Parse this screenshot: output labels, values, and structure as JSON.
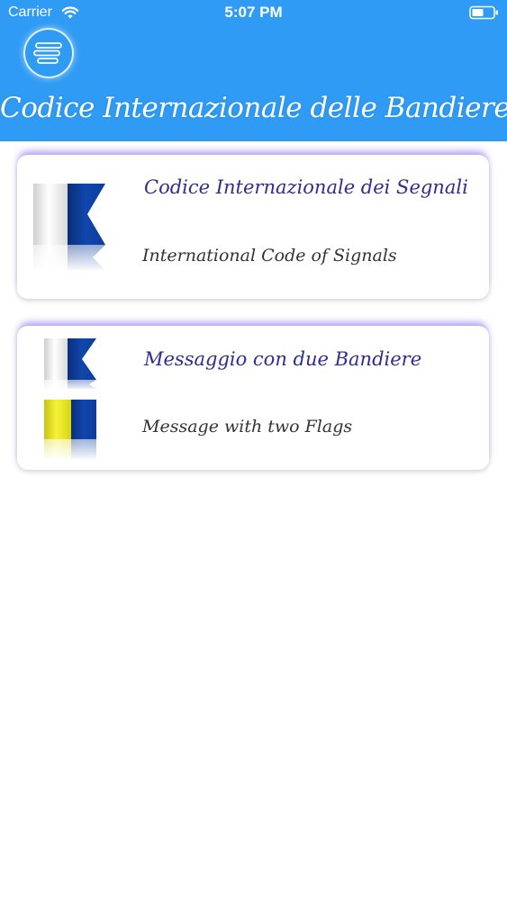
{
  "status_bar": {
    "carrier": "Carrier",
    "time": "5:07 PM",
    "wifi_icon": "wifi-icon",
    "battery_icon": "battery-icon"
  },
  "header": {
    "title": "Codice Internazionale delle Bandiere",
    "menu_icon": "menu-icon",
    "background_color": "#2f9bf4"
  },
  "cards": [
    {
      "title": "Codice Internazionale dei Segnali",
      "subtitle": "International Code of Signals",
      "icon": "flag-alpha-icon"
    },
    {
      "title": "Messaggio con due Bandiere",
      "subtitle": "Message with two Flags",
      "icon": "two-flags-icon"
    }
  ],
  "colors": {
    "title_text": "#2e2d8f",
    "subtitle_text": "#333333",
    "flag_blue": "#0b3d9a",
    "flag_yellow": "#f2ee16"
  }
}
